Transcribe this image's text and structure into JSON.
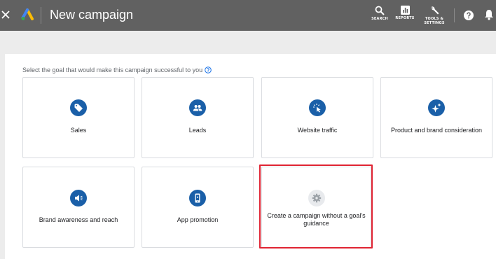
{
  "header": {
    "title": "New campaign",
    "close_icon": "close-icon",
    "logo": "google-ads-logo",
    "tools": [
      {
        "label": "SEARCH",
        "icon": "search-icon"
      },
      {
        "label": "REPORTS",
        "icon": "reports-icon"
      },
      {
        "label": "TOOLS &\nSETTINGS",
        "icon": "wrench-icon"
      }
    ],
    "help_icon": "help-icon",
    "notifications_icon": "bell-icon"
  },
  "goal_prompt": "Select the goal that would make this campaign successful to you",
  "goals": [
    {
      "label": "Sales",
      "icon": "tag-icon"
    },
    {
      "label": "Leads",
      "icon": "people-icon"
    },
    {
      "label": "Website traffic",
      "icon": "cursor-click-icon"
    },
    {
      "label": "Product and brand consideration",
      "icon": "sparkle-icon"
    },
    {
      "label": "Brand awareness and reach",
      "icon": "megaphone-icon"
    },
    {
      "label": "App promotion",
      "icon": "phone-icon"
    },
    {
      "label": "Create a campaign without a goal's guidance",
      "icon": "gear-icon"
    }
  ],
  "colors": {
    "header_bg": "#616161",
    "icon_circle": "#1a5fa8",
    "highlight": "#e02433"
  }
}
